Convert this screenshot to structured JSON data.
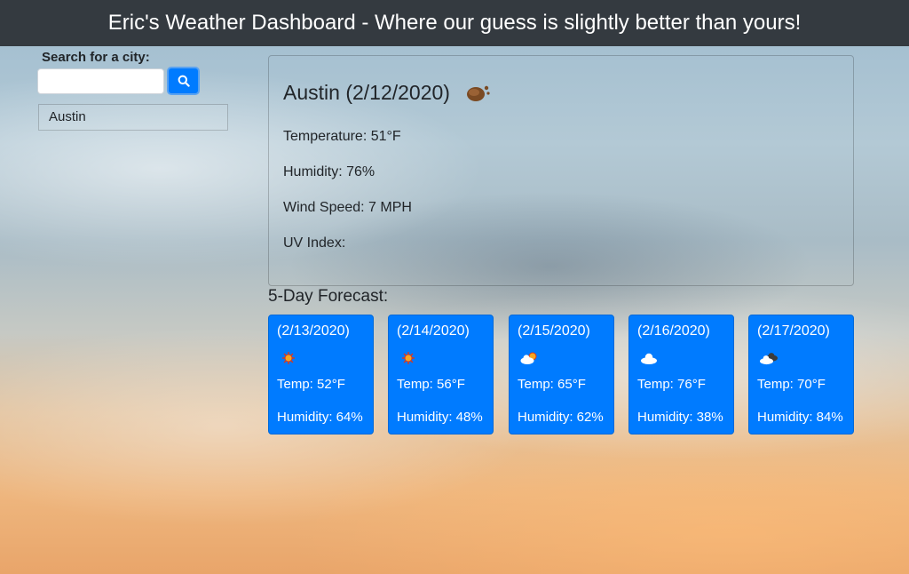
{
  "header": {
    "title": "Eric's Weather Dashboard - Where our guess is slightly better than yours!"
  },
  "search": {
    "label": "Search for a city:",
    "input_value": "",
    "button_icon": "search-icon",
    "history": [
      "Austin"
    ]
  },
  "current": {
    "title": "Austin (2/12/2020)",
    "icon": "rain-icon",
    "temperature": "Temperature: 51°F",
    "humidity": "Humidity: 76%",
    "wind": "Wind Speed: 7 MPH",
    "uv": "UV Index:"
  },
  "forecast": {
    "heading": "5-Day Forecast:",
    "days": [
      {
        "date": "(2/13/2020)",
        "icon": "sun-icon",
        "temp": "Temp: 52°F",
        "humidity": "Humidity: 64%"
      },
      {
        "date": "(2/14/2020)",
        "icon": "sun-icon",
        "temp": "Temp: 56°F",
        "humidity": "Humidity: 48%"
      },
      {
        "date": "(2/15/2020)",
        "icon": "partly-cloudy-icon",
        "temp": "Temp: 65°F",
        "humidity": "Humidity: 62%"
      },
      {
        "date": "(2/16/2020)",
        "icon": "cloud-icon",
        "temp": "Temp: 76°F",
        "humidity": "Humidity: 38%"
      },
      {
        "date": "(2/17/2020)",
        "icon": "dark-cloud-icon",
        "temp": "Temp: 70°F",
        "humidity": "Humidity: 84%"
      }
    ]
  },
  "colors": {
    "header_bg": "#343a40",
    "accent": "#007bff"
  }
}
